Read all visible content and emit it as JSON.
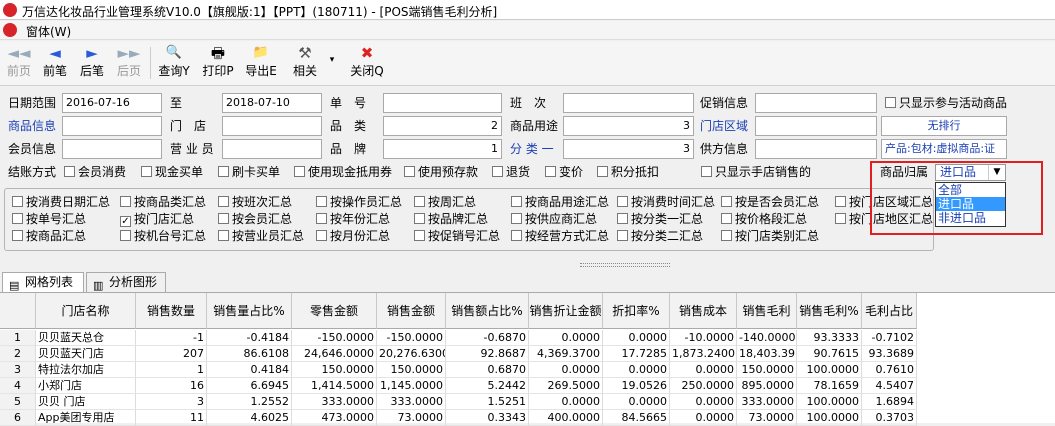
{
  "window": {
    "title": "万信达化妆品行业管理系统V10.0【旗舰版:1】【PPT】(180711) - [POS端销售毛利分析]"
  },
  "menu": {
    "item": "窗体(W)"
  },
  "toolbar": [
    {
      "label": "前页",
      "icon": "◄◄",
      "enabled": false
    },
    {
      "label": "前笔",
      "icon": "◄",
      "enabled": true
    },
    {
      "label": "后笔",
      "icon": "►",
      "enabled": true
    },
    {
      "label": "后页",
      "icon": "►►",
      "enabled": false
    },
    {
      "label": "查询Y",
      "icon": "🔍",
      "enabled": true
    },
    {
      "label": "打印P",
      "icon": "🖶",
      "enabled": true
    },
    {
      "label": "导出E",
      "icon": "📁",
      "enabled": true
    },
    {
      "label": "相关",
      "icon": "⚒",
      "enabled": true
    },
    {
      "label": "关闭Q",
      "icon": "✖",
      "enabled": true
    }
  ],
  "filters": {
    "date_range_label": "日期范围",
    "date_from": "2016-07-16",
    "to_label": "至",
    "date_to": "2018-07-10",
    "order_no_label": "单　号",
    "class_label": "班　次",
    "promo_label": "促销信息",
    "only_promo_label": "只显示参与活动商品",
    "goods_info_label": "商品信息",
    "store_label": "门　店",
    "category_label": "品　类",
    "category_value": "2",
    "goods_use_label": "商品用途",
    "goods_use_value": "3",
    "store_area_label": "门店区域",
    "rank_value": "无排行",
    "member_label": "会员信息",
    "salesman_label": "营 业 员",
    "brand_label": "品　牌",
    "brand_value": "1",
    "class1_label": "分 类 一",
    "class1_value": "3",
    "supplier_label": "供方信息",
    "product_value": "产品:包材:虚拟商品:证",
    "settle_label": "结账方式",
    "settle_options": [
      "会员消费",
      "现金买单",
      "刷卡买单",
      "使用现金抵用券",
      "使用预存款",
      "退货",
      "变价",
      "积分抵扣"
    ],
    "only_manual_label": "只显示手店销售的",
    "attr_label": "商品归属",
    "attr_selected": "进口品",
    "attr_options": [
      "全部",
      "进口品",
      "非进口品"
    ]
  },
  "summary": {
    "row1": [
      "按消费日期汇总",
      "按商品类汇总",
      "按班次汇总",
      "按操作员汇总",
      "按周汇总",
      "按商品用途汇总",
      "按消费时间汇总",
      "按是否会员汇总",
      "按门店区域汇总"
    ],
    "row2": [
      "按单号汇总",
      "按门店汇总",
      "按会员汇总",
      "按年份汇总",
      "按品牌汇总",
      "按供应商汇总",
      "按分类一汇总",
      "按价格段汇总",
      "按门店地区汇总"
    ],
    "row3": [
      "按商品汇总",
      "按机台号汇总",
      "按营业员汇总",
      "按月份汇总",
      "按促销号汇总",
      "按经营方式汇总",
      "按分类二汇总",
      "按门店类别汇总"
    ],
    "checked": "按门店汇总"
  },
  "tabs": [
    "网格列表",
    "分析图形"
  ],
  "table": {
    "headers": [
      "门店名称",
      "销售数量",
      "销售量占比%",
      "零售金额",
      "销售金额",
      "销售额占比%",
      "销售折让金额",
      "折扣率%",
      "销售成本",
      "销售毛利",
      "销售毛利%",
      "毛利占比"
    ],
    "rows": [
      [
        "1",
        "贝贝蓝天总仓",
        "-1",
        "-0.4184",
        "-150.0000",
        "-150.0000",
        "-0.6870",
        "0.0000",
        "0.0000",
        "-10.0000",
        "-140.0000",
        "93.3333",
        "-0.7102"
      ],
      [
        "2",
        "贝贝蓝天门店",
        "207",
        "86.6108",
        "24,646.0000",
        "20,276.6300",
        "92.8687",
        "4,369.3700",
        "17.7285",
        "1,873.2400",
        "18,403.39",
        "90.7615",
        "93.3689"
      ],
      [
        "3",
        "特拉法尔加店",
        "1",
        "0.4184",
        "150.0000",
        "150.0000",
        "0.6870",
        "0.0000",
        "0.0000",
        "0.0000",
        "150.0000",
        "100.0000",
        "0.7610"
      ],
      [
        "4",
        "小郑门店",
        "16",
        "6.6945",
        "1,414.5000",
        "1,145.0000",
        "5.2442",
        "269.5000",
        "19.0526",
        "250.0000",
        "895.0000",
        "78.1659",
        "4.5407"
      ],
      [
        "5",
        "贝贝 门店",
        "3",
        "1.2552",
        "333.0000",
        "333.0000",
        "1.5251",
        "0.0000",
        "0.0000",
        "0.0000",
        "333.0000",
        "100.0000",
        "1.6894"
      ],
      [
        "6",
        "App美团专用店",
        "11",
        "4.6025",
        "473.0000",
        "73.0000",
        "0.3343",
        "400.0000",
        "84.5665",
        "0.0000",
        "73.0000",
        "100.0000",
        "0.3703"
      ]
    ]
  }
}
